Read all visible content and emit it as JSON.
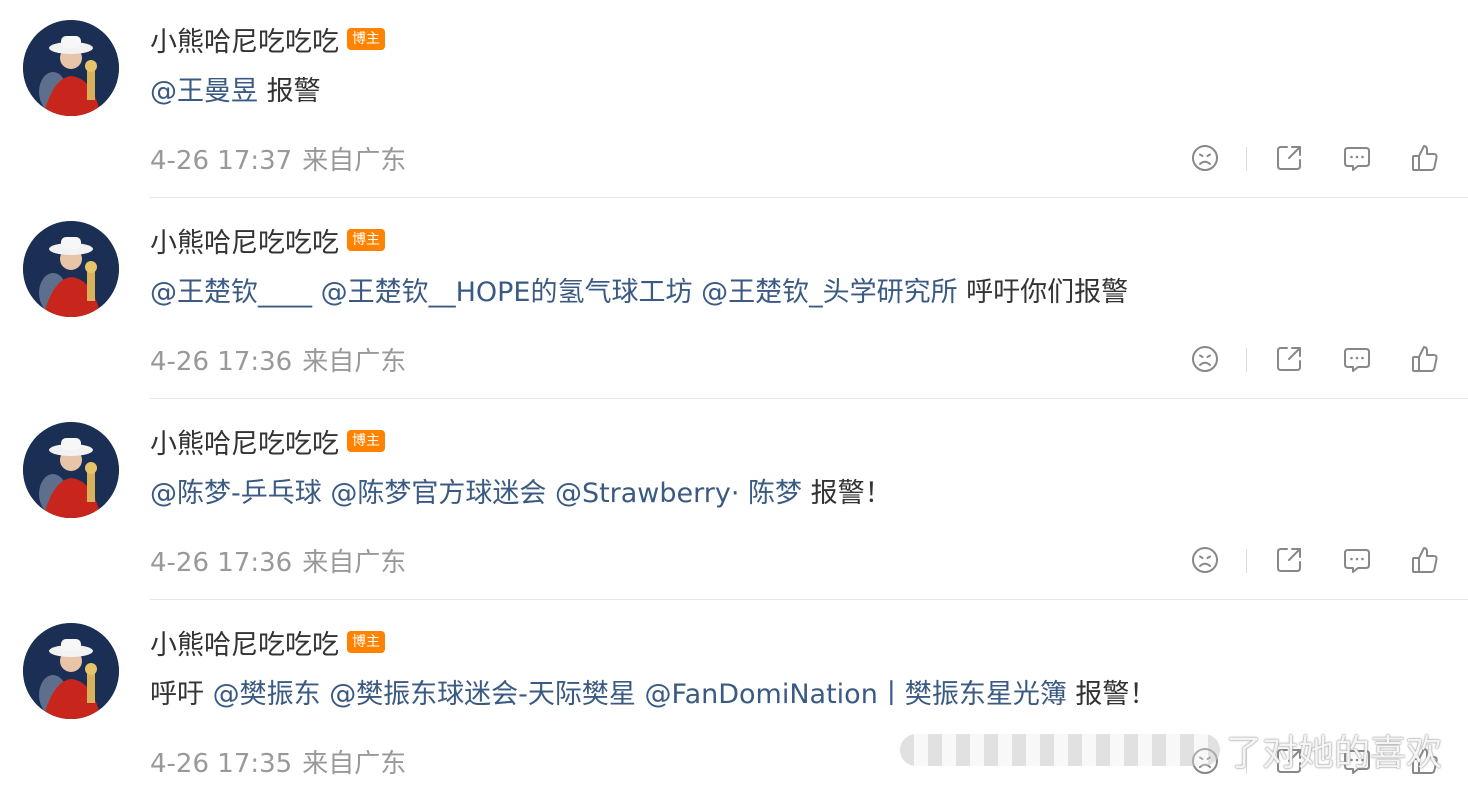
{
  "comments": [
    {
      "username": "小熊哈尼吃吃吃",
      "badge": "博主",
      "segments": [
        {
          "text": "@王曼昱",
          "type": "mention"
        },
        {
          "text": " 报警",
          "type": "text"
        }
      ],
      "time": "4-26 17:37",
      "location": "来自广东"
    },
    {
      "username": "小熊哈尼吃吃吃",
      "badge": "博主",
      "segments": [
        {
          "text": "@王楚钦____",
          "type": "mention"
        },
        {
          "text": " ",
          "type": "text"
        },
        {
          "text": "@王楚钦__HOPE的氢气球工坊",
          "type": "mention"
        },
        {
          "text": " ",
          "type": "text"
        },
        {
          "text": "@王楚钦_头学研究所",
          "type": "mention"
        },
        {
          "text": " 呼吁你们报警",
          "type": "text"
        }
      ],
      "time": "4-26 17:36",
      "location": "来自广东"
    },
    {
      "username": "小熊哈尼吃吃吃",
      "badge": "博主",
      "segments": [
        {
          "text": "@陈梦-乒乓球",
          "type": "mention"
        },
        {
          "text": " ",
          "type": "text"
        },
        {
          "text": "@陈梦官方球迷会",
          "type": "mention"
        },
        {
          "text": " ",
          "type": "text"
        },
        {
          "text": "@Strawberry· 陈梦",
          "type": "mention"
        },
        {
          "text": " 报警！",
          "type": "text"
        }
      ],
      "time": "4-26 17:36",
      "location": "来自广东"
    },
    {
      "username": "小熊哈尼吃吃吃",
      "badge": "博主",
      "segments": [
        {
          "text": "呼吁 ",
          "type": "text"
        },
        {
          "text": "@樊振东",
          "type": "mention"
        },
        {
          "text": " ",
          "type": "text"
        },
        {
          "text": "@樊振东球迷会-天际樊星",
          "type": "mention"
        },
        {
          "text": " ",
          "type": "text"
        },
        {
          "text": "@FanDomiNation丨樊振东星光簿",
          "type": "mention"
        },
        {
          "text": " 报警！",
          "type": "text"
        }
      ],
      "time": "4-26 17:35",
      "location": "来自广东"
    }
  ],
  "icons": {
    "dislike": "sad-face-icon",
    "share": "share-icon",
    "reply": "comment-icon",
    "like": "thumbs-up-icon"
  },
  "watermark": {
    "text": "了对她的喜欢"
  },
  "colors": {
    "mention": "#3b5a83",
    "badge": "#ff8200",
    "meta": "#999999",
    "text": "#333333"
  }
}
